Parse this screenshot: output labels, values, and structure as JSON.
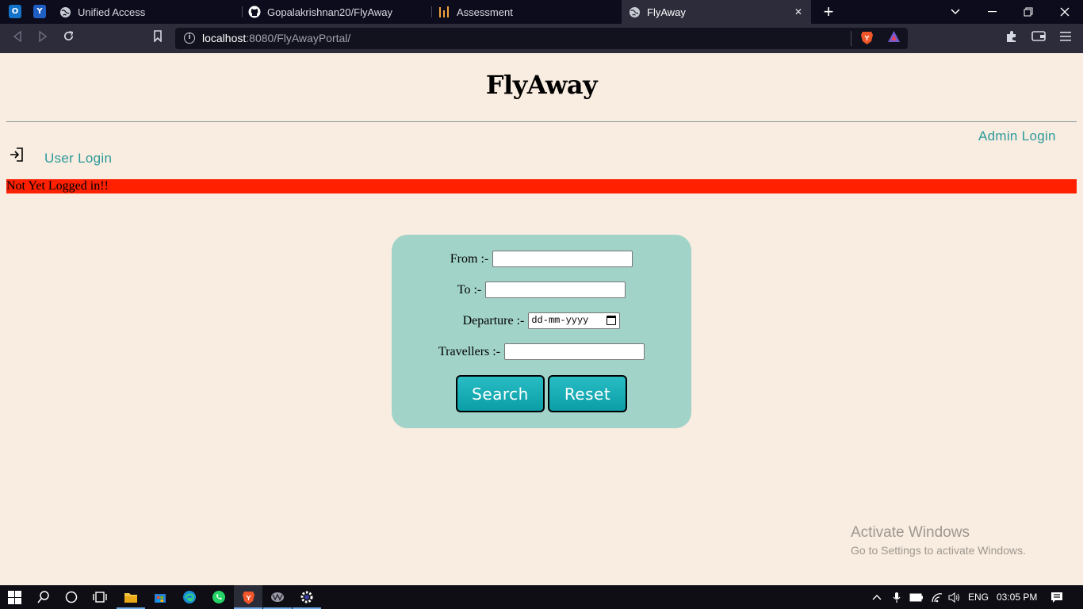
{
  "browser": {
    "tabs": [
      {
        "title": "Unified Access",
        "icon": "globe-icon",
        "active": false
      },
      {
        "title": "Gopalakrishnan20/FlyAway",
        "icon": "github-icon",
        "active": false
      },
      {
        "title": "Assessment",
        "icon": "chart-icon",
        "active": false
      },
      {
        "title": "FlyAway",
        "icon": "globe-icon",
        "active": true
      }
    ],
    "pinned": [
      {
        "letter": "O",
        "icon": "outlook-icon"
      },
      {
        "letter": "Y",
        "icon": "yammer-icon"
      }
    ],
    "url_host": "localhost",
    "url_path": ":8080/FlyAwayPortal/"
  },
  "page": {
    "title": "FlyAway",
    "admin_login": "Admin Login",
    "user_login": "User Login",
    "status": "Not Yet Logged in!!"
  },
  "form": {
    "from_label": "From :-",
    "to_label": "To :-",
    "departure_label": "Departure :-",
    "departure_placeholder": "dd-mm-yyyy",
    "travellers_label": "Travellers :-",
    "from_value": "",
    "to_value": "",
    "travellers_value": "",
    "search_label": "Search",
    "reset_label": "Reset"
  },
  "watermark": {
    "line1": "Activate Windows",
    "line2": "Go to Settings to activate Windows."
  },
  "taskbar": {
    "language": "ENG",
    "time": "03:05 PM"
  },
  "colors": {
    "page_bg": "#f9ece0",
    "accent_link": "#2b9a9a",
    "status_bg": "#ff2000",
    "panel_bg": "#a1d3c8",
    "button": "#0b9ea7"
  }
}
